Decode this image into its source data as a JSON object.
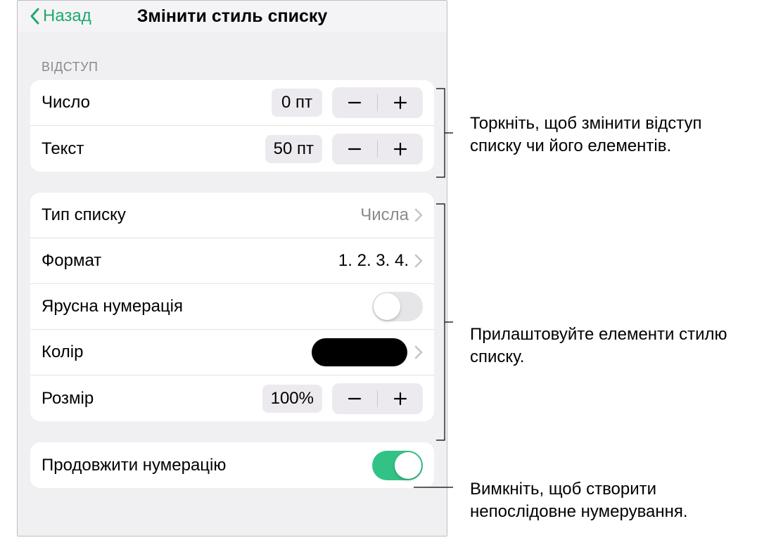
{
  "header": {
    "back_label": "Назад",
    "title": "Змінити стиль списку"
  },
  "indent": {
    "section_label": "ВІДСТУП",
    "number_label": "Число",
    "number_value": "0 пт",
    "text_label": "Текст",
    "text_value": "50 пт"
  },
  "style": {
    "list_type_label": "Тип списку",
    "list_type_value": "Числа",
    "format_label": "Формат",
    "format_value": "1. 2. 3. 4.",
    "tiered_label": "Ярусна нумерація",
    "tiered_on": false,
    "color_label": "Колір",
    "color_value": "#000000",
    "size_label": "Розмір",
    "size_value": "100%"
  },
  "continue": {
    "label": "Продовжити нумерацію",
    "on": true
  },
  "callouts": {
    "indent": "Торкніть, щоб змінити відступ списку чи його елементів.",
    "style": "Прилаштовуйте елементи стилю списку.",
    "continue": "Вимкніть, щоб створити непослідовне нумерування."
  }
}
